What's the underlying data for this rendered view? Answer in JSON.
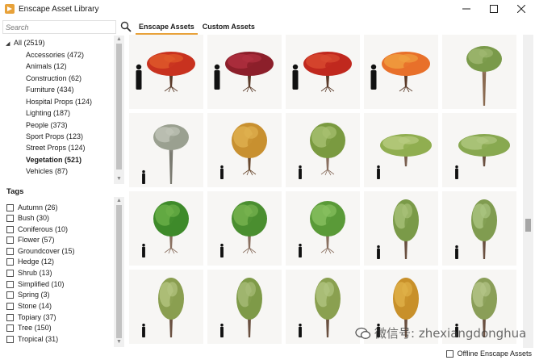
{
  "window": {
    "title": "Enscape Asset Library"
  },
  "search": {
    "placeholder": "Search"
  },
  "tabs": [
    {
      "label": "Enscape Assets",
      "active": true
    },
    {
      "label": "Custom Assets",
      "active": false
    }
  ],
  "categories": {
    "root": "All (2519)",
    "items": [
      {
        "label": "Accessories (472)",
        "bold": false
      },
      {
        "label": "Animals (12)",
        "bold": false
      },
      {
        "label": "Construction (62)",
        "bold": false
      },
      {
        "label": "Furniture (434)",
        "bold": false
      },
      {
        "label": "Hospital Props (124)",
        "bold": false
      },
      {
        "label": "Lighting (187)",
        "bold": false
      },
      {
        "label": "People (373)",
        "bold": false
      },
      {
        "label": "Sport Props (123)",
        "bold": false
      },
      {
        "label": "Street Props (124)",
        "bold": false
      },
      {
        "label": "Vegetation (521)",
        "bold": true
      },
      {
        "label": "Vehicles (87)",
        "bold": false
      }
    ]
  },
  "tags": {
    "header": "Tags",
    "items": [
      "Autumn (26)",
      "Bush (30)",
      "Coniferous (10)",
      "Flower (57)",
      "Groundcover (15)",
      "Hedge (12)",
      "Shrub (13)",
      "Simplified (10)",
      "Spring (3)",
      "Stone (14)",
      "Topiary (37)",
      "Tree (150)",
      "Tropical (31)"
    ]
  },
  "grid": {
    "assets": [
      {
        "name": "red-maple-tree",
        "crown": "#c8321f",
        "crown2": "#e05a2a",
        "trunk": "#5a3a28",
        "figure": true,
        "shape": "spread"
      },
      {
        "name": "dark-red-maple-tree",
        "crown": "#8c1f2a",
        "crown2": "#b03040",
        "trunk": "#5a3a28",
        "figure": true,
        "shape": "spread"
      },
      {
        "name": "japanese-maple-red",
        "crown": "#c0281e",
        "crown2": "#d84a30",
        "trunk": "#5a3a28",
        "figure": true,
        "shape": "spread"
      },
      {
        "name": "orange-maple-tree",
        "crown": "#e8702a",
        "crown2": "#f0a040",
        "trunk": "#5a3a28",
        "figure": true,
        "shape": "spread"
      },
      {
        "name": "sparse-green-tree",
        "crown": "#7a9a4a",
        "crown2": "#a0b870",
        "trunk": "#8a6a50",
        "figure": false,
        "shape": "sparse"
      },
      {
        "name": "bare-birch-tree",
        "crown": "#9aa090",
        "crown2": "#c0c4b8",
        "trunk": "#7a7a70",
        "figure": true,
        "shape": "sparse"
      },
      {
        "name": "yellow-autumn-oak",
        "crown": "#c89030",
        "crown2": "#e0b050",
        "trunk": "#6a4a30",
        "figure": true,
        "shape": "round"
      },
      {
        "name": "green-oak-roots",
        "crown": "#7a9a40",
        "crown2": "#a8c070",
        "trunk": "#8a7060",
        "figure": true,
        "shape": "round"
      },
      {
        "name": "light-green-oak",
        "crown": "#90ae50",
        "crown2": "#b8cc80",
        "trunk": "#7a6050",
        "figure": true,
        "shape": "wide"
      },
      {
        "name": "wide-olive-tree",
        "crown": "#88a850",
        "crown2": "#b0c880",
        "trunk": "#6a5040",
        "figure": true,
        "shape": "wide"
      },
      {
        "name": "lush-green-tree-a",
        "crown": "#3e8a2a",
        "crown2": "#6cb048",
        "trunk": "#8a7060",
        "figure": true,
        "shape": "round"
      },
      {
        "name": "lush-green-tree-b",
        "crown": "#4a8e30",
        "crown2": "#78b450",
        "trunk": "#8a7060",
        "figure": true,
        "shape": "round"
      },
      {
        "name": "lush-green-tree-c",
        "crown": "#5a9a38",
        "crown2": "#88c060",
        "trunk": "#8a7060",
        "figure": true,
        "shape": "round"
      },
      {
        "name": "tall-green-tree-a",
        "crown": "#7a9a48",
        "crown2": "#a8c078",
        "trunk": "#6a5040",
        "figure": true,
        "shape": "tall"
      },
      {
        "name": "tall-green-tree-b",
        "crown": "#809c50",
        "crown2": "#aac480",
        "trunk": "#6a5040",
        "figure": true,
        "shape": "tall"
      },
      {
        "name": "slim-tree-a",
        "crown": "#8a9e50",
        "crown2": "#b4c480",
        "trunk": "#6a5040",
        "figure": true,
        "shape": "tall"
      },
      {
        "name": "slim-tree-b",
        "crown": "#7e9a48",
        "crown2": "#a8bc78",
        "trunk": "#6a5040",
        "figure": true,
        "shape": "tall"
      },
      {
        "name": "slim-tree-c",
        "crown": "#8aa050",
        "crown2": "#b0c480",
        "trunk": "#6a5040",
        "figure": true,
        "shape": "tall"
      },
      {
        "name": "slim-autumn-tree",
        "crown": "#c8902a",
        "crown2": "#e0b048",
        "trunk": "#6a5040",
        "figure": true,
        "shape": "tall"
      },
      {
        "name": "slim-tree-d",
        "crown": "#8a9e58",
        "crown2": "#b4c488",
        "trunk": "#6a5040",
        "figure": true,
        "shape": "tall"
      }
    ]
  },
  "footer": {
    "offline_label": "Offline Enscape Assets",
    "watermark": "微信号: zhexiangdonghua"
  },
  "colors": {
    "accent": "#e8a23a",
    "scrollbar": "#c2c2c2",
    "cell_bg": "#f7f6f4"
  },
  "icons": [
    "enscape-logo-icon",
    "minimize-icon",
    "maximize-icon",
    "close-icon",
    "search-icon",
    "expand-tree-icon",
    "wechat-icon"
  ]
}
